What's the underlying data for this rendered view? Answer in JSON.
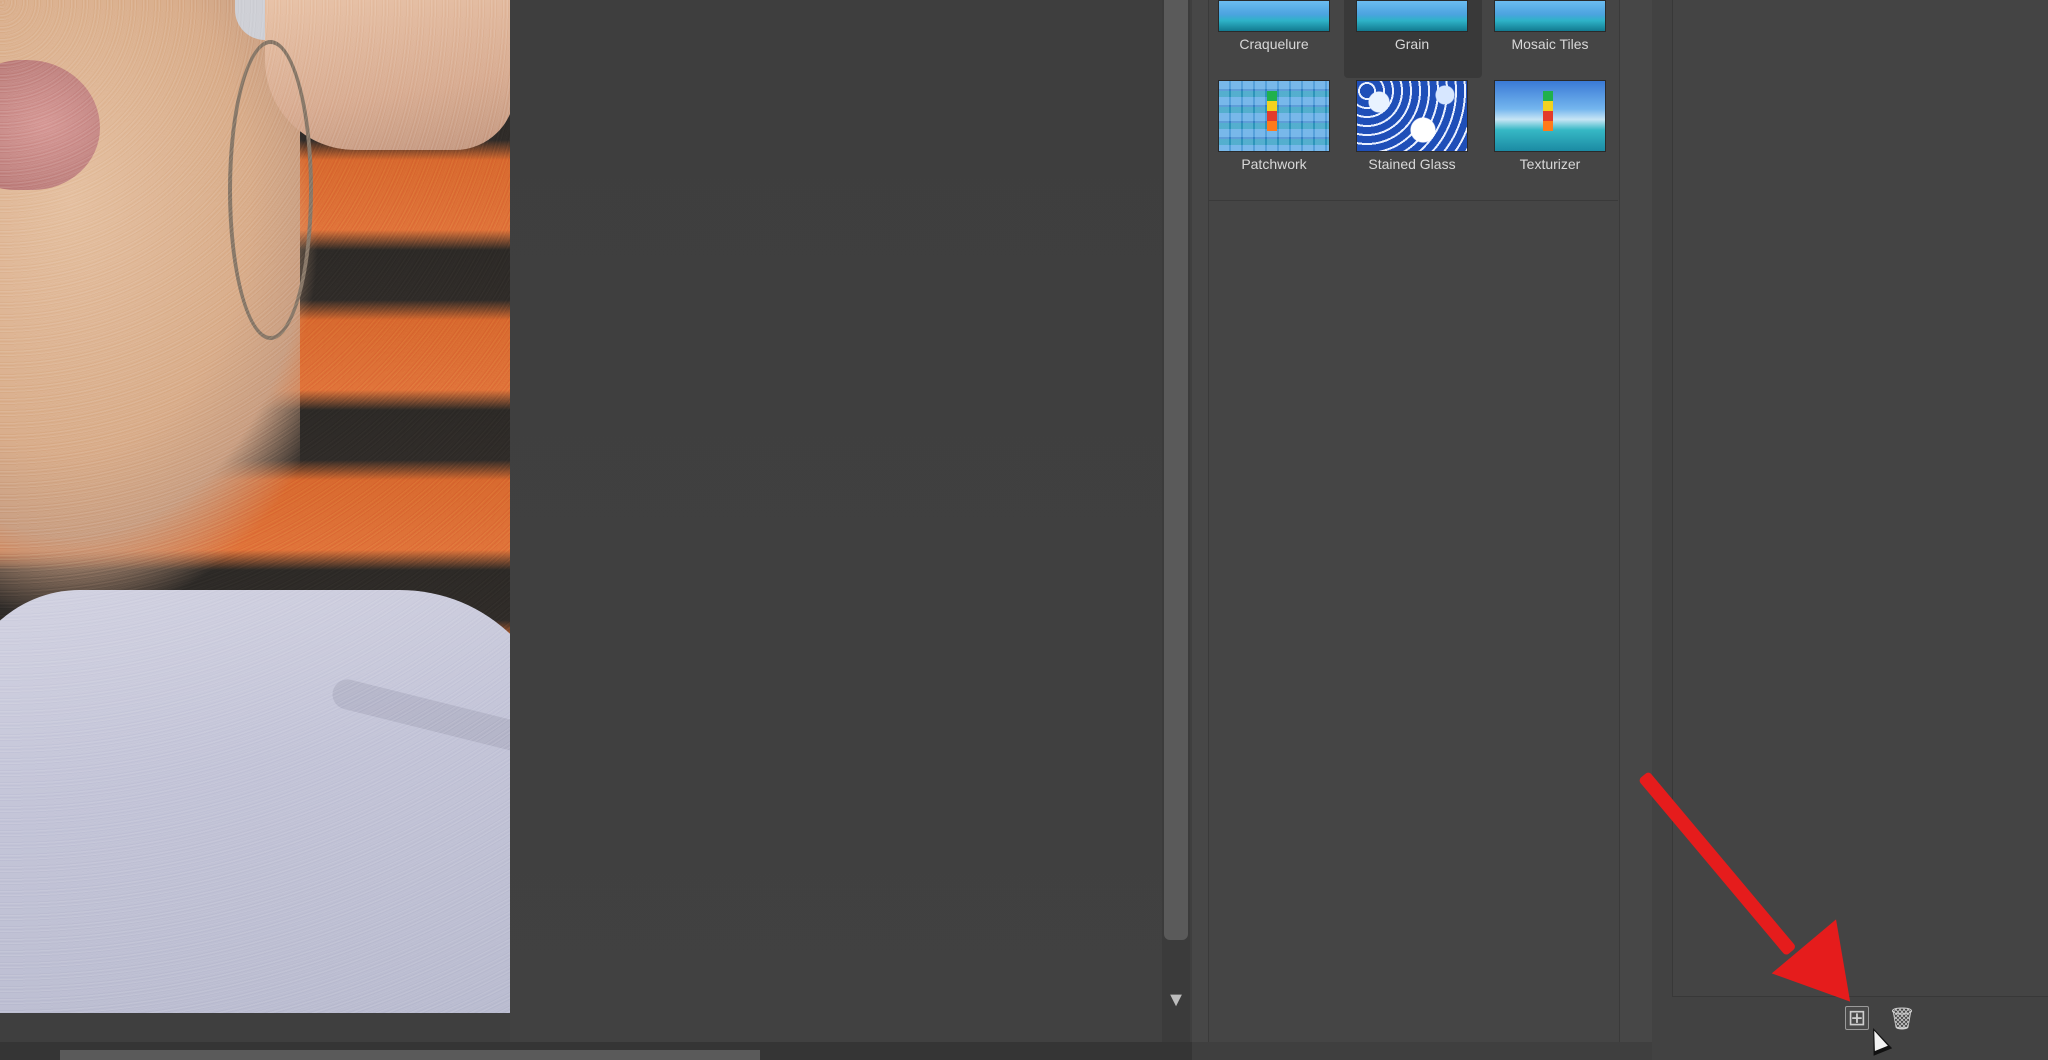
{
  "filter_gallery": {
    "filters": [
      {
        "label": "Craquelure"
      },
      {
        "label": "Grain"
      },
      {
        "label": "Mosaic Tiles"
      },
      {
        "label": "Patchwork"
      },
      {
        "label": "Stained Glass"
      },
      {
        "label": "Texturizer"
      }
    ],
    "selected": "Grain"
  },
  "layers_panel": {
    "new_layer_icon": "plus-square-icon",
    "delete_icon": "trash-icon"
  },
  "scrollbar": {
    "down_glyph": "▼"
  },
  "glyphs": {
    "plus": "⊞",
    "trash": "🗑"
  }
}
